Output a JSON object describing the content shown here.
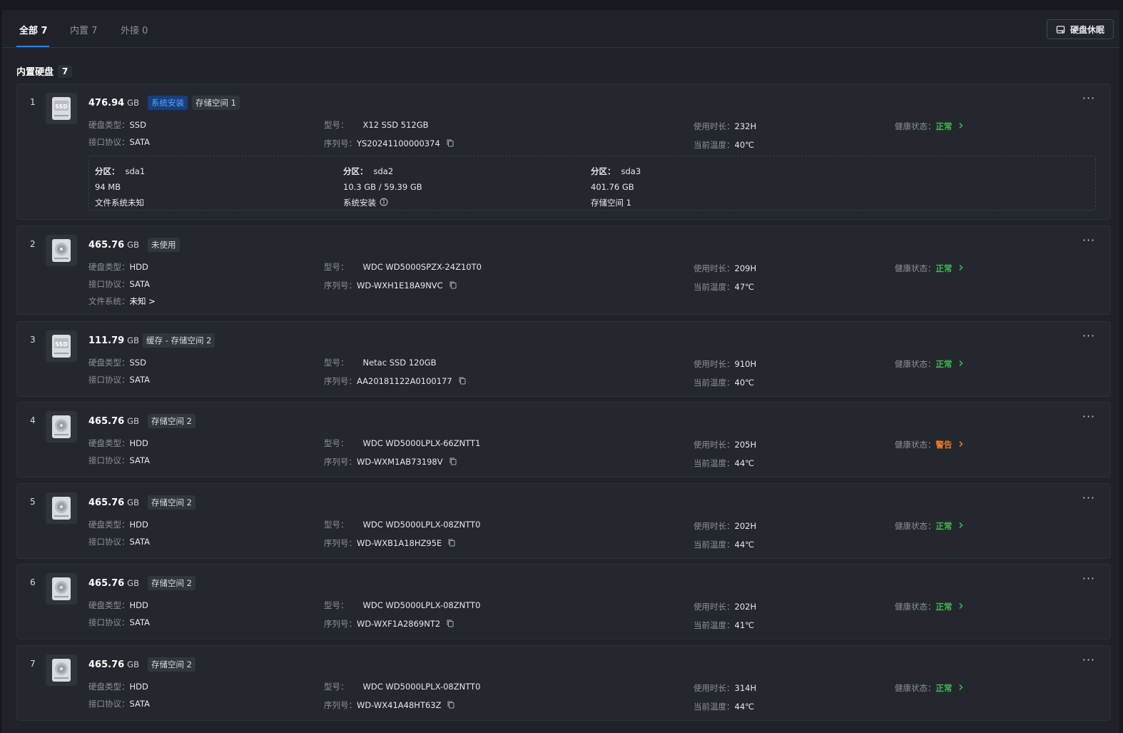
{
  "tabs": [
    {
      "label": "全部 7"
    },
    {
      "label": "内置 7"
    },
    {
      "label": "外接 0"
    }
  ],
  "sleep_button": {
    "label": "硬盘休眠",
    "icon": "disk-sleep-icon"
  },
  "section": {
    "title": "内置硬盘",
    "count": "7"
  },
  "labels": {
    "disk_type": "硬盘类型：",
    "interface": "接口协议：",
    "model": "型号：",
    "serial": "序列号：",
    "usage_time": "使用时长：",
    "temperature": "当前温度：",
    "health": "健康状态：",
    "filesystem": "文件系统：",
    "partition": "分区："
  },
  "disks": [
    {
      "index": "1",
      "capacity": "476.94",
      "unit": "GB",
      "icon": "ssd-icon",
      "tags": [
        {
          "text": "系统安装",
          "style": "blue"
        },
        {
          "text": "存储空间 1",
          "style": "gray"
        }
      ],
      "type": "SSD",
      "interface": "SATA",
      "model": "X12 SSD 512GB",
      "serial": "YS20241100000374",
      "usage": "232H",
      "temp": "40℃",
      "health": "正常",
      "health_color": "#3fb950",
      "partitions": [
        {
          "name": "sda1",
          "size": "94 MB",
          "desc": "文件系统未知"
        },
        {
          "name": "sda2",
          "size": "10.3 GB / 59.39 GB",
          "desc": "系统安装"
        },
        {
          "name": "sda3",
          "size": "401.76 GB",
          "desc": "存储空间 1"
        }
      ]
    },
    {
      "index": "2",
      "capacity": "465.76",
      "unit": "GB",
      "icon": "hdd-icon",
      "tags": [
        {
          "text": "未使用",
          "style": "gray"
        }
      ],
      "type": "HDD",
      "interface": "SATA",
      "model": "WDC WD5000SPZX-24Z10T0",
      "serial": "WD-WXH1E18A9NVC",
      "usage": "209H",
      "temp": "47℃",
      "health": "正常",
      "health_color": "#3fb950",
      "filesystem": "未知 >"
    },
    {
      "index": "3",
      "capacity": "111.79",
      "unit": "GB",
      "icon": "ssd-icon",
      "tags": [
        {
          "text": "缓存 - 存储空间 2",
          "style": "gray"
        }
      ],
      "type": "SSD",
      "interface": "SATA",
      "model": "Netac SSD 120GB",
      "serial": "AA20181122A0100177",
      "usage": "910H",
      "temp": "40℃",
      "health": "正常",
      "health_color": "#3fb950"
    },
    {
      "index": "4",
      "capacity": "465.76",
      "unit": "GB",
      "icon": "hdd-icon",
      "tags": [
        {
          "text": "存储空间 2",
          "style": "gray"
        }
      ],
      "type": "HDD",
      "interface": "SATA",
      "model": "WDC WD5000LPLX-66ZNTT1",
      "serial": "WD-WXM1AB73198V",
      "usage": "205H",
      "temp": "44℃",
      "health": "警告",
      "health_color": "#ef7a2f"
    },
    {
      "index": "5",
      "capacity": "465.76",
      "unit": "GB",
      "icon": "hdd-icon",
      "tags": [
        {
          "text": "存储空间 2",
          "style": "gray"
        }
      ],
      "type": "HDD",
      "interface": "SATA",
      "model": "WDC WD5000LPLX-08ZNTT0",
      "serial": "WD-WXB1A18HZ95E",
      "usage": "202H",
      "temp": "44℃",
      "health": "正常",
      "health_color": "#3fb950"
    },
    {
      "index": "6",
      "capacity": "465.76",
      "unit": "GB",
      "icon": "hdd-icon",
      "tags": [
        {
          "text": "存储空间 2",
          "style": "gray"
        }
      ],
      "type": "HDD",
      "interface": "SATA",
      "model": "WDC WD5000LPLX-08ZNTT0",
      "serial": "WD-WXF1A2869NT2",
      "usage": "202H",
      "temp": "41℃",
      "health": "正常",
      "health_color": "#3fb950"
    },
    {
      "index": "7",
      "capacity": "465.76",
      "unit": "GB",
      "icon": "hdd-icon",
      "tags": [
        {
          "text": "存储空间 2",
          "style": "gray"
        }
      ],
      "type": "HDD",
      "interface": "SATA",
      "model": "WDC WD5000LPLX-08ZNTT0",
      "serial": "WD-WX41A48HT63Z",
      "usage": "314H",
      "temp": "44℃",
      "health": "正常",
      "health_color": "#3fb950"
    }
  ]
}
